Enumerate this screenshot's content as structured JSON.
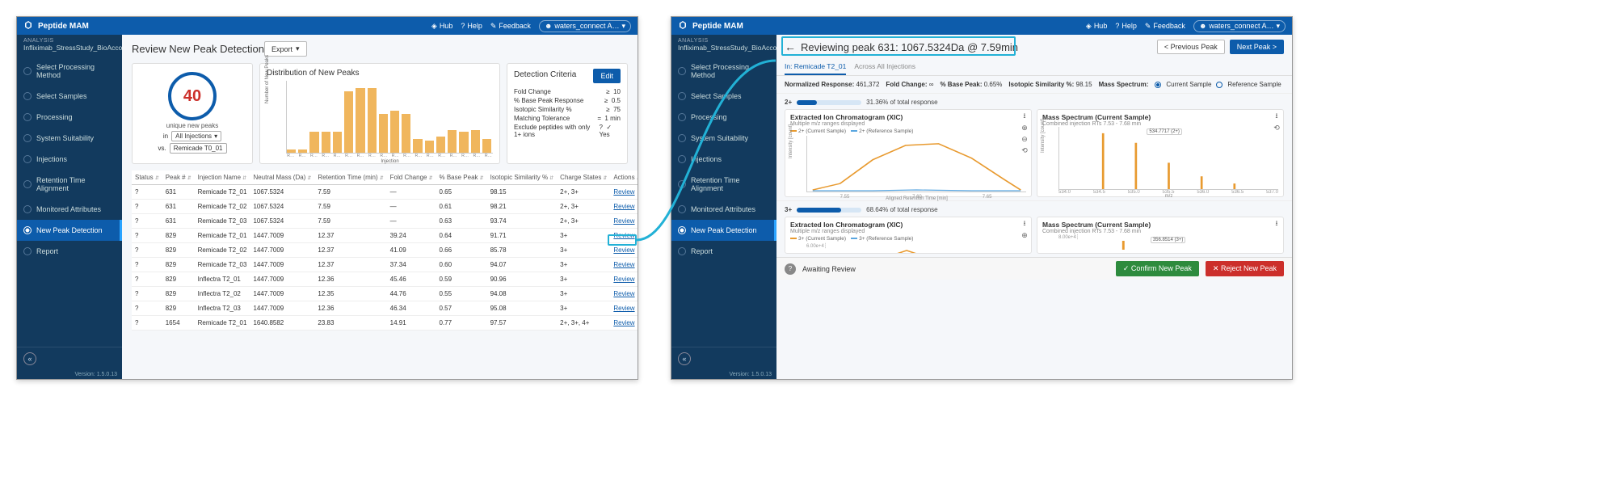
{
  "app": {
    "title": "Peptide MAM"
  },
  "titlebar": {
    "hub": "Hub",
    "help": "Help",
    "feedback": "Feedback",
    "user": "waters_connect A…"
  },
  "sidebar": {
    "analysis_header": "ANALYSIS",
    "analysis_name": "Infliximab_StressStudy_BioAccord",
    "steps": [
      {
        "label": "Select Processing Method"
      },
      {
        "label": "Select Samples"
      },
      {
        "label": "Processing"
      },
      {
        "label": "System Suitability"
      },
      {
        "label": "Injections"
      },
      {
        "label": "Retention Time Alignment"
      },
      {
        "label": "Monitored Attributes"
      },
      {
        "label": "New Peak Detection"
      },
      {
        "label": "Report"
      }
    ],
    "active_step_index": 7,
    "version": "Version: 1.5.0.13"
  },
  "page1": {
    "title": "Review New Peak Detection",
    "export": "Export",
    "summary": {
      "count": "40",
      "caption": "unique new peaks",
      "in_label": "in",
      "in_value": "All Injections",
      "vs_label": "vs.",
      "vs_value": "Remicade T0_01"
    },
    "dist": {
      "title": "Distribution of New Peaks"
    },
    "criteria": {
      "title": "Detection Criteria",
      "edit": "Edit",
      "rows": [
        {
          "k": "Fold Change",
          "op": "≥",
          "v": "10"
        },
        {
          "k": "% Base Peak Response",
          "op": "≥",
          "v": "0.5"
        },
        {
          "k": "Isotopic Similarity %",
          "op": "≥",
          "v": "75"
        },
        {
          "k": "Matching Tolerance",
          "op": "=",
          "v": "1 min"
        },
        {
          "k": "Exclude peptides with only 1+ ions",
          "op": "?",
          "v": "✓ Yes"
        }
      ]
    },
    "columns": [
      "Status",
      "Peak #",
      "Injection Name",
      "Neutral Mass (Da)",
      "Retention Time (min)",
      "Fold Change",
      "% Base Peak",
      "Isotopic Similarity %",
      "Charge States",
      "Actions"
    ],
    "review": "Review",
    "rows": [
      {
        "status": "?",
        "peak": "631",
        "inj": "Remicade T2_01",
        "mass": "1067.5324",
        "rt": "7.59",
        "fc": "—",
        "bp": "0.65",
        "iso": "98.15",
        "cs": "2+, 3+"
      },
      {
        "status": "?",
        "peak": "631",
        "inj": "Remicade T2_02",
        "mass": "1067.5324",
        "rt": "7.59",
        "fc": "—",
        "bp": "0.61",
        "iso": "98.21",
        "cs": "2+, 3+"
      },
      {
        "status": "?",
        "peak": "631",
        "inj": "Remicade T2_03",
        "mass": "1067.5324",
        "rt": "7.59",
        "fc": "—",
        "bp": "0.63",
        "iso": "93.74",
        "cs": "2+, 3+"
      },
      {
        "status": "?",
        "peak": "829",
        "inj": "Remicade T2_01",
        "mass": "1447.7009",
        "rt": "12.37",
        "fc": "39.24",
        "bp": "0.64",
        "iso": "91.71",
        "cs": "3+"
      },
      {
        "status": "?",
        "peak": "829",
        "inj": "Remicade T2_02",
        "mass": "1447.7009",
        "rt": "12.37",
        "fc": "41.09",
        "bp": "0.66",
        "iso": "85.78",
        "cs": "3+"
      },
      {
        "status": "?",
        "peak": "829",
        "inj": "Remicade T2_03",
        "mass": "1447.7009",
        "rt": "12.37",
        "fc": "37.34",
        "bp": "0.60",
        "iso": "94.07",
        "cs": "3+"
      },
      {
        "status": "?",
        "peak": "829",
        "inj": "Inflectra T2_01",
        "mass": "1447.7009",
        "rt": "12.36",
        "fc": "45.46",
        "bp": "0.59",
        "iso": "90.96",
        "cs": "3+"
      },
      {
        "status": "?",
        "peak": "829",
        "inj": "Inflectra T2_02",
        "mass": "1447.7009",
        "rt": "12.35",
        "fc": "44.76",
        "bp": "0.55",
        "iso": "94.08",
        "cs": "3+"
      },
      {
        "status": "?",
        "peak": "829",
        "inj": "Inflectra T2_03",
        "mass": "1447.7009",
        "rt": "12.36",
        "fc": "46.34",
        "bp": "0.57",
        "iso": "95.08",
        "cs": "3+"
      },
      {
        "status": "?",
        "peak": "1654",
        "inj": "Remicade T2_01",
        "mass": "1640.8582",
        "rt": "23.83",
        "fc": "14.91",
        "bp": "0.77",
        "iso": "97.57",
        "cs": "2+, 3+, 4+"
      }
    ]
  },
  "page2": {
    "back_title": "Reviewing peak 631: 1067.5324Da @ 7.59min",
    "prev": "< Previous Peak",
    "next": "Next Peak >",
    "tabs": {
      "t1": "In: Remicade T2_01",
      "t2": "Across All Injections"
    },
    "metrics": {
      "nr_label": "Normalized Response:",
      "nr_val": "461,372",
      "fc_label": "Fold Change:",
      "fc_val": "∞",
      "bp_label": "% Base Peak:",
      "bp_val": "0.65%",
      "iso_label": "Isotopic Similarity %:",
      "iso_val": "98.15",
      "ms_label": "Mass Spectrum:",
      "ms_cur": "Current Sample",
      "ms_ref": "Reference Sample"
    },
    "charge2": {
      "label": "2+",
      "pct": "31.36% of total response",
      "fill": 31
    },
    "charge3": {
      "label": "3+",
      "pct": "68.64% of total response",
      "fill": 69
    },
    "xic": {
      "title": "Extracted Ion Chromatogram (XIC)",
      "sub": "Multiple m/z ranges displayed",
      "leg_cur": "2+ (Current Sample)",
      "leg_ref": "2+ (Reference Sample)",
      "ylab": "Intensity [count]",
      "xlab": "Aligned Retention Time [min]",
      "xt1": "7.55",
      "xt2": "7.60",
      "xt3": "7.65"
    },
    "ms": {
      "title": "Mass Spectrum (Current Sample)",
      "sub": "Combined injection RTs 7.53 - 7.68 min",
      "ylab": "Intensity [count]",
      "xlab": "m/z",
      "ann1": "534.7717 (2+)",
      "ann2": "356.8514 (3+)",
      "xt": [
        "534.0",
        "534.5",
        "535.0",
        "535.5",
        "536.0",
        "536.5",
        "537.0"
      ]
    },
    "xic3": {
      "leg_cur": "3+ (Current Sample)",
      "leg_ref": "3+ (Reference Sample)"
    },
    "footer": {
      "status": "Awaiting Review",
      "confirm": "✓ Confirm New Peak",
      "reject": "✕ Reject New Peak"
    }
  },
  "chart_data": {
    "type": "bar",
    "title": "Distribution of New Peaks",
    "xlabel": "Injection",
    "ylabel": "Number of New Peaks",
    "ylim": [
      0,
      40
    ],
    "categories": [
      "R…",
      "R…",
      "R…",
      "R…",
      "R…",
      "R…",
      "R…",
      "R…",
      "R…",
      "R…",
      "R…",
      "R…",
      "R…",
      "R…",
      "R…",
      "R…",
      "R…",
      "R…"
    ],
    "values": [
      2,
      2,
      12,
      12,
      12,
      35,
      37,
      37,
      22,
      24,
      22,
      8,
      7,
      9,
      13,
      12,
      13,
      8
    ]
  }
}
